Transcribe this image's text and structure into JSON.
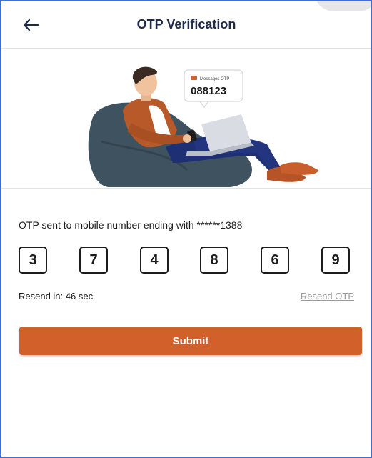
{
  "header": {
    "title": "OTP Verification",
    "back_icon": "arrow-left-icon"
  },
  "illustration": {
    "bubble_label": "Messages OTP",
    "bubble_code": "088123"
  },
  "otp": {
    "message": "OTP sent to mobile number ending with ******1388",
    "digits": [
      "3",
      "7",
      "4",
      "8",
      "6",
      "9"
    ]
  },
  "resend": {
    "timer_text": "Resend in: 46 sec",
    "link_label": "Resend OTP"
  },
  "submit_label": "Submit",
  "colors": {
    "accent": "#d2602a",
    "title": "#1e2a4a",
    "frame": "#3b6fd4"
  }
}
